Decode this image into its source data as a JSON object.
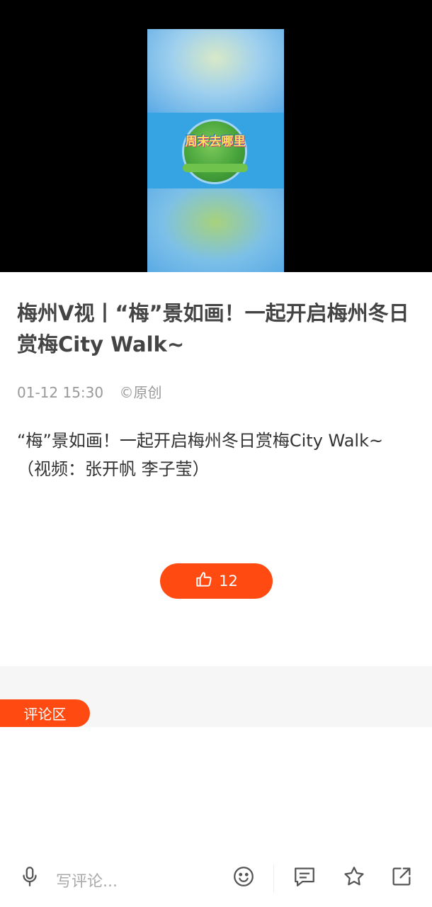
{
  "video": {
    "thumbnail_icon": "video-thumbnail",
    "logo_text": "周末去哪里"
  },
  "article": {
    "title": "梅州V视丨“梅”景如画！一起开启梅州冬日赏梅City Walk~",
    "time": "01-12 15:30",
    "source": "©原创",
    "body_line1": "“梅”景如画！一起开启梅州冬日赏梅City Walk~",
    "body_line2": "（视频：张开帆 李子莹）"
  },
  "like": {
    "icon": "thumb-up-icon",
    "count": "12"
  },
  "comments": {
    "section_label": "评论区"
  },
  "bottom_bar": {
    "mic_icon": "mic-icon",
    "placeholder": "写评论...",
    "emoji_icon": "emoji-icon",
    "comments_icon": "comment-icon",
    "favorite_icon": "star-icon",
    "share_icon": "share-icon"
  },
  "colors": {
    "accent": "#ff4b12",
    "video_bg": "#000000",
    "band_bg": "#f6f6f6"
  }
}
